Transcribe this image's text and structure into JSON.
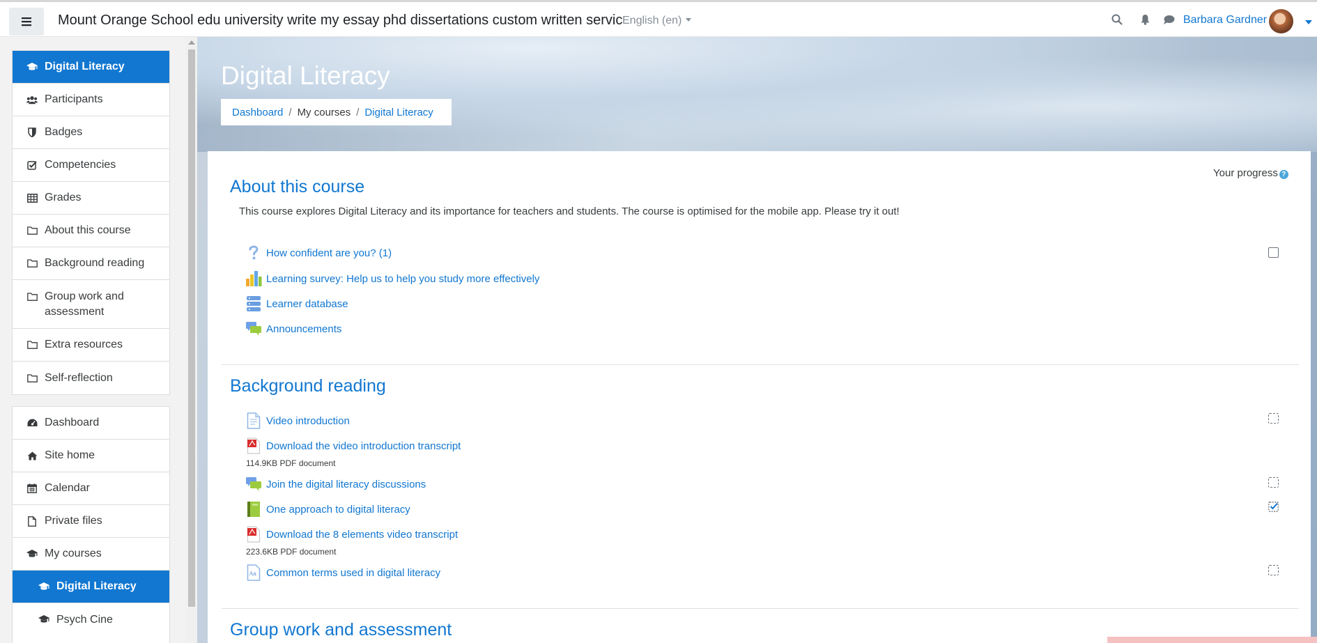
{
  "navbar": {
    "site_name": "Mount Orange School edu university write my essay phd dissertations custom written servic",
    "language": "English (en)",
    "user_name": "Barbara Gardner",
    "icons": [
      "hamburger-icon",
      "search-icon",
      "bell-icon",
      "chat-icon"
    ]
  },
  "drawer": {
    "course_nav": [
      {
        "label": "Digital Literacy",
        "icon": "graduation-cap-icon",
        "active": true
      },
      {
        "label": "Participants",
        "icon": "users-icon"
      },
      {
        "label": "Badges",
        "icon": "shield-icon"
      },
      {
        "label": "Competencies",
        "icon": "check-square-icon"
      },
      {
        "label": "Grades",
        "icon": "table-icon"
      },
      {
        "label": "About this course",
        "icon": "folder-icon"
      },
      {
        "label": "Background reading",
        "icon": "folder-icon"
      },
      {
        "label": "Group work and assessment",
        "icon": "folder-icon"
      },
      {
        "label": "Extra resources",
        "icon": "folder-icon"
      },
      {
        "label": "Self-reflection",
        "icon": "folder-icon"
      }
    ],
    "site_nav": [
      {
        "label": "Dashboard",
        "icon": "dashboard-icon"
      },
      {
        "label": "Site home",
        "icon": "home-icon"
      },
      {
        "label": "Calendar",
        "icon": "calendar-icon"
      },
      {
        "label": "Private files",
        "icon": "file-icon"
      },
      {
        "label": "My courses",
        "icon": "graduation-cap-icon"
      },
      {
        "label": "Digital Literacy",
        "icon": "graduation-cap-icon",
        "active": true
      },
      {
        "label": "Psych Cine",
        "icon": "graduation-cap-icon"
      }
    ]
  },
  "header": {
    "title": "Digital Literacy",
    "breadcrumb": [
      "Dashboard",
      "My courses",
      "Digital Literacy"
    ]
  },
  "progress_label": "Your progress",
  "sections": [
    {
      "title": "About this course",
      "summary": "This course explores Digital Literacy and its importance for teachers and students. The course is optimised for the mobile app. Please try it out!",
      "activities": [
        {
          "label": "How confident are you? (1)",
          "icon": "question-icon",
          "completion": "manual"
        },
        {
          "label": "Learning survey: Help us to help you study more effectively",
          "icon": "survey-icon"
        },
        {
          "label": "Learner database",
          "icon": "database-icon"
        },
        {
          "label": "Announcements",
          "icon": "forum-icon"
        }
      ]
    },
    {
      "title": "Background reading",
      "activities": [
        {
          "label": "Video introduction",
          "icon": "page-icon",
          "completion": "auto"
        },
        {
          "label": "Download the video introduction transcript",
          "icon": "pdf-icon",
          "meta": "114.9KB PDF document"
        },
        {
          "label": "Join the digital literacy discussions",
          "icon": "forum-icon",
          "completion": "auto"
        },
        {
          "label": "One approach to digital literacy",
          "icon": "book-icon",
          "completion": "auto-complete"
        },
        {
          "label": "Download the 8 elements video transcript",
          "icon": "pdf-icon",
          "meta": "223.6KB PDF document"
        },
        {
          "label": "Common terms used in digital literacy",
          "icon": "glossary-icon",
          "completion": "auto"
        }
      ]
    },
    {
      "title": "Group work and assessment"
    }
  ],
  "colors": {
    "accent": "#1177d1",
    "drawer_bg": "#f2f2f2"
  }
}
